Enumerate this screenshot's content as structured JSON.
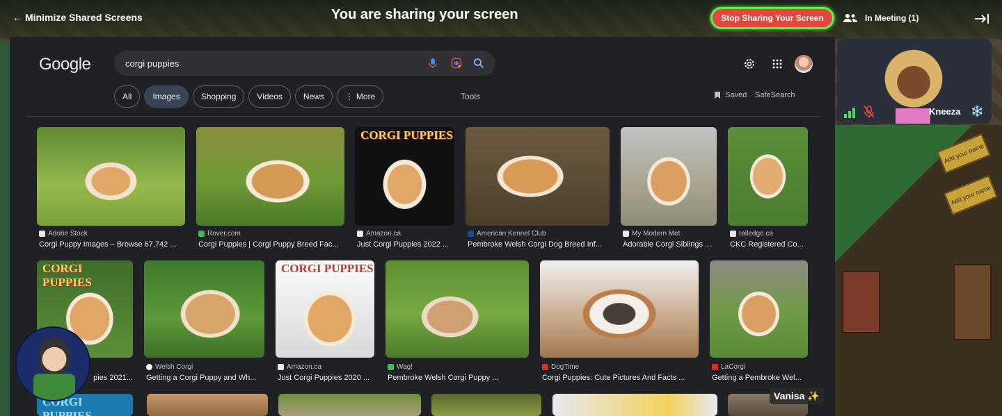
{
  "topbar": {
    "minimize_label": "Minimize Shared Screens",
    "sharing_title": "You are sharing your screen",
    "stop_label": "Stop Sharing Your Screen",
    "meeting_label": "In Meeting (1)"
  },
  "google": {
    "logo": "Google",
    "query": "corgi puppies",
    "chips": [
      "All",
      "Images",
      "Shopping",
      "Videos",
      "News",
      "More"
    ],
    "active_chip": "Images",
    "tools": "Tools",
    "saved": "Saved",
    "safesearch": "SafeSearch",
    "results_row1": [
      {
        "source": "Adobe Stock",
        "title": "Corgi Puppy Images – Browse 67,742 ..."
      },
      {
        "source": "Rover.com",
        "title": "Corgi Puppies | Corgi Puppy Breed Fac..."
      },
      {
        "source": "Amazon.ca",
        "title": "Just Corgi Puppies 2022 ...",
        "cover": "CORGI PUPPIES"
      },
      {
        "source": "American Kennel Club",
        "title": "Pembroke Welsh Corgi Dog Breed Inf..."
      },
      {
        "source": "My Modern Met",
        "title": "Adorable Corgi Siblings ..."
      },
      {
        "source": "railedge.ca",
        "title": "CKC Registered Co..."
      }
    ],
    "results_row2": [
      {
        "source": "",
        "title": "pies 2021...",
        "cover": "CORGI PUPPIES"
      },
      {
        "source": "Welsh Corgi",
        "title": "Getting a Corgi Puppy and Wh..."
      },
      {
        "source": "Amazon.ca",
        "title": "Just Corgi Puppies 2020 ...",
        "cover": "CORGI PUPPIES"
      },
      {
        "source": "Wag!",
        "title": "Pembroke Welsh Corgi Puppy ..."
      },
      {
        "source": "DogTime",
        "title": "Corgi Puppies: Cute Pictures And Facts ..."
      },
      {
        "source": "LaCorgi",
        "title": "Getting a Pembroke Wel..."
      }
    ],
    "row3_cover": "CORGI PUPPIES"
  },
  "tile": {
    "name": "Kneeza",
    "badge": "❄️"
  },
  "self": {
    "name": "Vanisa",
    "badge": "✨"
  },
  "game": {
    "plaque1": "Add your name",
    "plaque2": "Add your name"
  },
  "colors": {
    "stop_bg": "#e0473f",
    "stop_border": "#5ef04a",
    "google_bg": "#202124"
  }
}
